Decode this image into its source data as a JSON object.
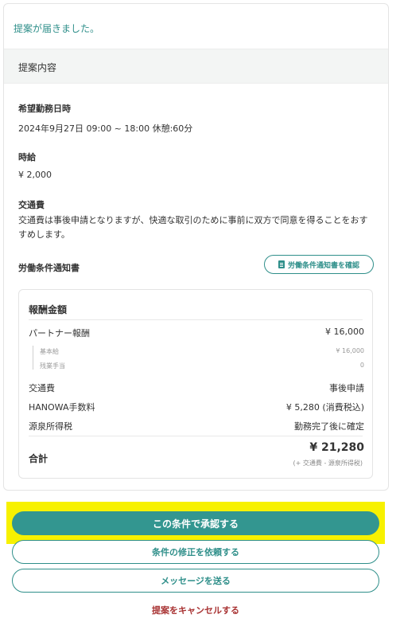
{
  "notice": "提案が届きました。",
  "section_title": "提案内容",
  "fields": {
    "datetime_label": "希望勤務日時",
    "datetime_value": "2024年9月27日 09:00 ~ 18:00 休憩:60分",
    "wage_label": "時給",
    "wage_value": "¥ 2,000",
    "transport_label": "交通費",
    "transport_value": "交通費は事後申請となりますが、快適な取引のために事前に双方で同意を得ることをおすすめします。",
    "notice_doc_label": "労働条件通知書",
    "notice_doc_button": "労働条件通知書を確認",
    "notice_doc_icon": "document-icon"
  },
  "fee": {
    "title": "報酬金額",
    "partner_label": "パートナー報酬",
    "partner_value": "¥ 16,000",
    "base_label": "基本給",
    "base_value": "¥ 16,000",
    "overtime_label": "残業手当",
    "overtime_value": "0",
    "transport_label": "交通費",
    "transport_value": "事後申請",
    "hanowa_label": "HANOWA手数料",
    "hanowa_value": "¥ 5,280 (消費税込)",
    "tax_label": "源泉所得税",
    "tax_value": "勤務完了後に確定",
    "total_label": "合計",
    "total_value": "¥ 21,280",
    "total_note": "(+ 交通費 - 源泉所得税)"
  },
  "buttons": {
    "approve": "この条件で承認する",
    "request_change": "条件の修正を依頼する",
    "send_message": "メッセージを送る",
    "cancel": "提案をキャンセルする"
  },
  "colors": {
    "accent": "#339690",
    "highlight": "#f7f100",
    "cancel": "#a83232"
  }
}
